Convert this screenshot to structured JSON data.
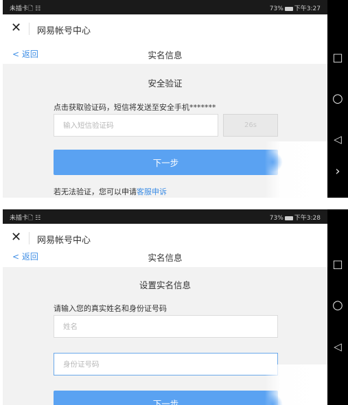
{
  "screen1": {
    "status": {
      "left": "未插卡🗋 ☷",
      "battery_pct": "73%",
      "time": "下午3:27"
    },
    "app_title": "网易帐号中心",
    "back_label": "< 返回",
    "page_title": "实名信息",
    "section_title": "安全验证",
    "hint": "点击获取验证码，短信将发送至安全手机*******",
    "sms_placeholder": "输入短信验证码",
    "countdown": "26s",
    "next_label": "下一步",
    "footer_prefix": "若无法验证，您可以申请",
    "footer_link": "客服申诉"
  },
  "screen2": {
    "status": {
      "left": "未插卡🗋 ☷",
      "battery_pct": "73%",
      "time": "下午3:28"
    },
    "app_title": "网易帐号中心",
    "back_label": "< 返回",
    "page_title": "实名信息",
    "section_title": "设置实名信息",
    "hint": "请输入您的真实姓名和身份证号码",
    "name_placeholder": "姓名",
    "id_placeholder": "身份证号码",
    "next_label": "下一步"
  },
  "nav_icons": [
    "square-icon",
    "circle-icon",
    "back-triangle-icon",
    "chevron-right-icon"
  ],
  "colors": {
    "accent": "#3d8de5",
    "button": "#5aa2f2",
    "page_bg": "#f2f2f2"
  }
}
